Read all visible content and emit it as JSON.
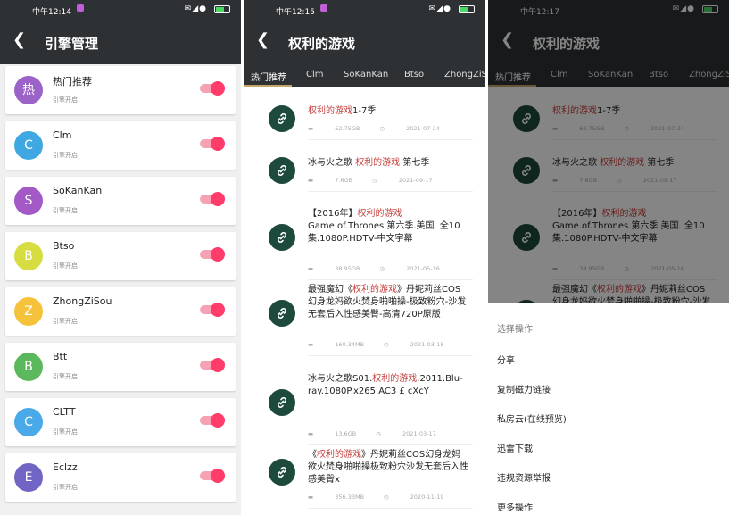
{
  "screen1": {
    "status_time": "中午12:14",
    "title": "引擎管理",
    "engines": [
      {
        "avatar": "热",
        "name": "热门推荐",
        "sub": "引擎开启",
        "color": "#9b62c8"
      },
      {
        "avatar": "C",
        "name": "Clm",
        "sub": "引擎开启",
        "color": "#3fa7e2"
      },
      {
        "avatar": "S",
        "name": "SoKanKan",
        "sub": "引擎开启",
        "color": "#a359c6"
      },
      {
        "avatar": "B",
        "name": "Btso",
        "sub": "引擎开启",
        "color": "#d7dc41"
      },
      {
        "avatar": "Z",
        "name": "ZhongZiSou",
        "sub": "引擎开启",
        "color": "#f5c23b"
      },
      {
        "avatar": "B",
        "name": "Btt",
        "sub": "引擎开启",
        "color": "#5cb85c"
      },
      {
        "avatar": "C",
        "name": "CLTT",
        "sub": "引擎开启",
        "color": "#4aa9e8"
      },
      {
        "avatar": "E",
        "name": "Eclzz",
        "sub": "引擎开启",
        "color": "#7064c4"
      }
    ]
  },
  "screen2": {
    "status_time": "中午12:15",
    "title": "权利的游戏",
    "tabs": [
      "热门推荐",
      "Clm",
      "SoKanKan",
      "Btso",
      "ZhongZiS"
    ],
    "results": [
      {
        "pre": "",
        "hl": "权利的游戏",
        "post": "1-7季",
        "size": "62.75GB",
        "date": "2021-07-24"
      },
      {
        "pre": "冰与火之歌 ",
        "hl": "权利的游戏",
        "post": " 第七季",
        "size": "7.6GB",
        "date": "2021-09-17"
      },
      {
        "pre": "【2016年】",
        "hl": "权利的游戏",
        "post": " Game.of.Thrones.第六季.美国. 全10集.1080P.HDTV-中文字幕",
        "size": "38.95GB",
        "date": "2021-05-16"
      },
      {
        "pre": "最强魔幻《",
        "hl": "权利的游戏",
        "post": "》丹妮莉丝COS幻身龙妈欲火焚身啪啪操-极致粉穴-沙发无套后入性感美臀-高清720P原版",
        "size": "160.34MB",
        "date": "2021-03-18"
      },
      {
        "pre": "冰与火之歌S01.",
        "hl": "权利的游戏",
        "post": ".2011.Blu-ray.1080P.x265.AC3 £ cXcY",
        "size": "13.6GB",
        "date": "2021-03-17"
      },
      {
        "pre": "《",
        "hl": "权利的游戏",
        "post": "》丹妮莉丝COS幻身龙妈欲火焚身啪啪操极致粉穴沙发无套后入性感美臀x",
        "size": "356.33MB",
        "date": "2020-11-19"
      }
    ]
  },
  "screen3": {
    "status_time": "中午12:17",
    "title": "权利的游戏",
    "sheet_title": "选择操作",
    "options": [
      "分享",
      "复制磁力链接",
      "私房云(在线预览)",
      "迅雷下载",
      "违规资源举报",
      "更多操作"
    ]
  }
}
